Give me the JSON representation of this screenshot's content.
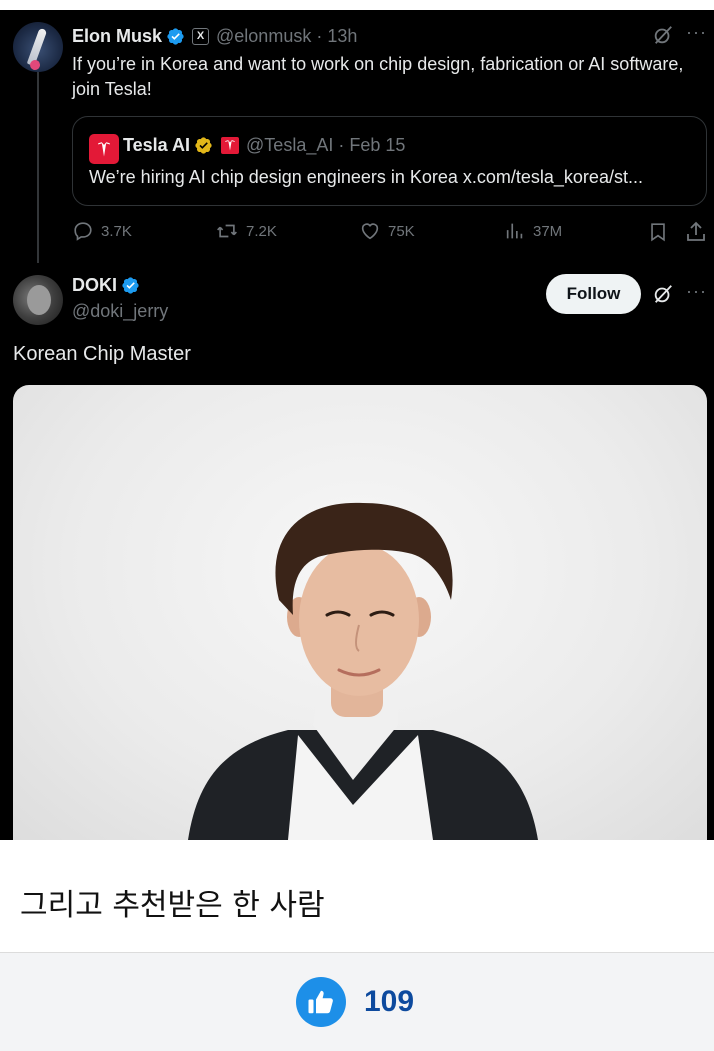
{
  "tweet1": {
    "author_name": "Elon Musk",
    "author_handle": "@elonmusk",
    "separator": "·",
    "time": "13h",
    "affiliate_badge": "X",
    "text": "If you’re in Korea and want to work on chip design, fabrication or AI software, join Tesla!",
    "quote": {
      "author_name": "Tesla AI",
      "author_handle": "@Tesla_AI",
      "separator": "·",
      "date": "Feb 15",
      "text": "We’re hiring AI chip design engineers in Korea x.com/tesla_korea/st..."
    },
    "actions": {
      "replies": "3.7K",
      "reposts": "7.2K",
      "likes": "75K",
      "views": "37M"
    },
    "more": "···"
  },
  "post2": {
    "author_name": "DOKI",
    "author_handle": "@doki_jerry",
    "follow_label": "Follow",
    "text": "Korean Chip Master",
    "more": "···"
  },
  "caption": "그리고 추천받은 한 사람",
  "like_count": "109",
  "colors": {
    "verified_blue": "#1d9bf0",
    "verified_gold": "#e2b719",
    "tesla_red": "#e31937",
    "like_blue": "#1d8fe8",
    "like_count": "#0d4a9e"
  }
}
